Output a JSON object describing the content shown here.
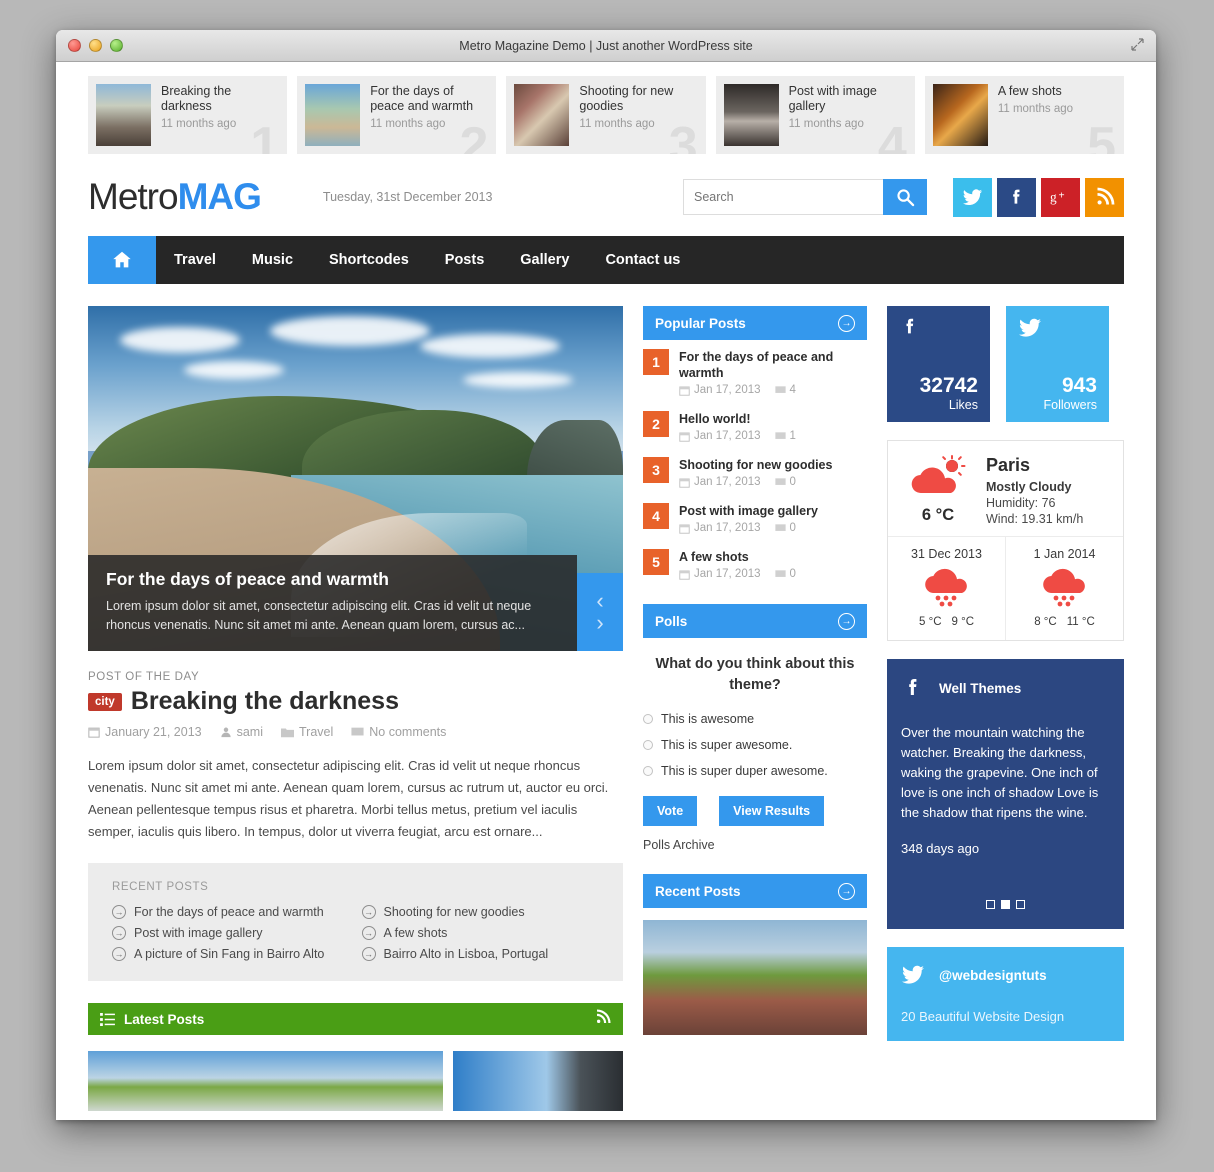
{
  "window": {
    "title": "Metro Magazine Demo | Just another WordPress site",
    "resize_icon": "resize-icon"
  },
  "ticker": [
    {
      "title": "Breaking the darkness",
      "time": "11 months ago",
      "number": "1"
    },
    {
      "title": "For the days of peace and warmth",
      "time": "11 months ago",
      "number": "2"
    },
    {
      "title": "Shooting for new goodies",
      "time": "11 months ago",
      "number": "3"
    },
    {
      "title": "Post with image gallery",
      "time": "11 months ago",
      "number": "4"
    },
    {
      "title": "A few shots",
      "time": "11 months ago",
      "number": "5"
    }
  ],
  "header": {
    "logo_a": "Metro",
    "logo_b": "MAG",
    "date": "Tuesday, 31st December 2013",
    "search_placeholder": "Search",
    "search_value": "",
    "socials": [
      "twitter",
      "facebook",
      "googleplus",
      "rss"
    ]
  },
  "nav": {
    "home_icon": "home-icon",
    "items": [
      "Travel",
      "Music",
      "Shortcodes",
      "Posts",
      "Gallery",
      "Contact us"
    ]
  },
  "slider": {
    "title": "For the days of peace and warmth",
    "excerpt": "Lorem ipsum dolor sit amet, consectetur adipiscing elit. Cras id velit ut neque rhoncus venenatis. Nunc sit amet mi ante. Aenean quam lorem, cursus ac...",
    "prev": "‹",
    "next": "›"
  },
  "post_of_the_day": {
    "kicker": "POST OF THE DAY",
    "category": "city",
    "title": "Breaking the darkness",
    "date": "January 21, 2013",
    "author": "sami",
    "section": "Travel",
    "comments": "No comments",
    "body": "Lorem ipsum dolor sit amet, consectetur adipiscing elit. Cras id velit ut neque rhoncus venenatis. Nunc sit amet mi ante. Aenean quam lorem, cursus ac rutrum ut, auctor eu orci. Aenean pellentesque tempus risus et pharetra. Morbi tellus metus, pretium vel iaculis semper, iaculis quis libero. In tempus, dolor ut viverra feugiat, arcu est ornare..."
  },
  "recent_posts_box": {
    "heading": "RECENT POSTS",
    "items": [
      "For the days of peace and warmth",
      "Shooting for new goodies",
      "Post with image gallery",
      "A few shots",
      "A picture of Sin Fang in Bairro Alto",
      "Bairro Alto in Lisboa, Portugal"
    ]
  },
  "latest_posts_bar": {
    "title": "Latest Posts",
    "list_icon": "list-icon",
    "rss_icon": "rss-icon"
  },
  "popular_posts": {
    "title": "Popular Posts",
    "more_icon": "arrow-circle-icon",
    "items": [
      {
        "rank": "1",
        "title": "For the days of peace and warmth",
        "date": "Jan 17, 2013",
        "comments": "4"
      },
      {
        "rank": "2",
        "title": "Hello world!",
        "date": "Jan 17, 2013",
        "comments": "1"
      },
      {
        "rank": "3",
        "title": "Shooting for new goodies",
        "date": "Jan 17, 2013",
        "comments": "0"
      },
      {
        "rank": "4",
        "title": "Post with image gallery",
        "date": "Jan 17, 2013",
        "comments": "0"
      },
      {
        "rank": "5",
        "title": "A few shots",
        "date": "Jan 17, 2013",
        "comments": "0"
      }
    ]
  },
  "polls": {
    "title": "Polls",
    "more_icon": "arrow-circle-icon",
    "question": "What do you think about this theme?",
    "options": [
      "This is awesome",
      "This is super awesome.",
      "This is super duper awesome."
    ],
    "vote_label": "Vote",
    "results_label": "View Results",
    "archive_label": "Polls Archive"
  },
  "recent_posts_widget": {
    "title": "Recent Posts",
    "more_icon": "arrow-circle-icon"
  },
  "counters": {
    "facebook": {
      "icon": "facebook-icon",
      "count": "32742",
      "label": "Likes"
    },
    "twitter": {
      "icon": "twitter-icon",
      "count": "943",
      "label": "Followers"
    }
  },
  "weather": {
    "icon": "cloud-sun-icon",
    "temp": "6 °C",
    "city": "Paris",
    "condition": "Mostly Cloudy",
    "humidity": "Humidity: 76",
    "wind": "Wind: 19.31 km/h",
    "forecast": [
      {
        "date": "31 Dec 2013",
        "icon": "cloud-snow-icon",
        "low": "5 °C",
        "high": "9 °C"
      },
      {
        "date": "1 Jan 2014",
        "icon": "cloud-snow-icon",
        "low": "8 °C",
        "high": "11 °C"
      }
    ]
  },
  "facebook_widget": {
    "icon": "facebook-icon",
    "name": "Well Themes",
    "text": "Over the mountain watching the watcher. Breaking the darkness, waking the grapevine. One inch of love is one inch of shadow Love is the shadow that ripens the wine.",
    "ago": "348 days ago",
    "dots": [
      "off",
      "on",
      "off"
    ]
  },
  "twitter_widget": {
    "icon": "twitter-icon",
    "handle": "@webdesigntuts",
    "text": "20 Beautiful Website Design"
  },
  "colors": {
    "accent_blue": "#3498ed",
    "orange": "#e8622a",
    "green": "#4a9e15",
    "fb_blue": "#2b4a86",
    "tw_blue": "#45b6ef",
    "gplus_red": "#cc2127",
    "rss_orange": "#f29100",
    "badge_red": "#c0392b",
    "nav_dark": "#262626"
  }
}
